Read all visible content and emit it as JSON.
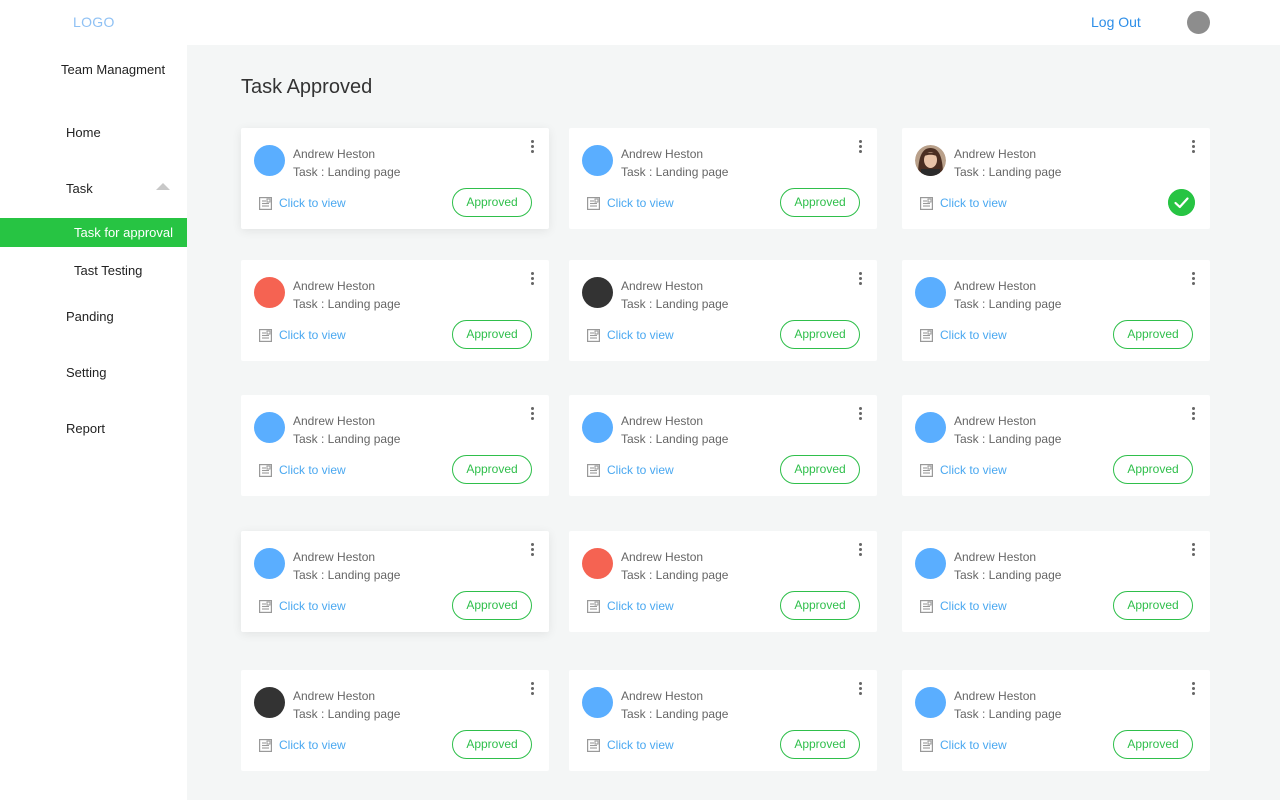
{
  "header": {
    "logo": "LOGO",
    "logout_label": "Log Out"
  },
  "sidebar": {
    "brand": "Team Managment",
    "items": [
      {
        "label": "Home"
      },
      {
        "label": "Task"
      },
      {
        "label": "Task for approval"
      },
      {
        "label": "Tast Testing"
      },
      {
        "label": "Panding"
      },
      {
        "label": "Setting"
      },
      {
        "label": "Report"
      }
    ]
  },
  "main": {
    "title": "Task Approved"
  },
  "colors": {
    "accent_green": "#27c443",
    "link_blue": "#4aa8f0",
    "avatar_blue": "#5aaeff",
    "avatar_red": "#f56352",
    "avatar_dark": "#333333"
  },
  "cards": [
    {
      "name": "Andrew Heston",
      "task": "Task : Landing page",
      "link": "Click to view",
      "status": "Approved",
      "avatar": "blue",
      "shadow": true
    },
    {
      "name": "Andrew Heston",
      "task": "Task : Landing page",
      "link": "Click to view",
      "status": "Approved",
      "avatar": "blue",
      "shadow": false
    },
    {
      "name": "Andrew Heston",
      "task": "Task : Landing page",
      "link": "Click to view",
      "status": "check-icon",
      "avatar": "photo",
      "shadow": false
    },
    {
      "name": "Andrew Heston",
      "task": "Task : Landing page",
      "link": "Click to view",
      "status": "Approved",
      "avatar": "red",
      "shadow": false
    },
    {
      "name": "Andrew Heston",
      "task": "Task : Landing page",
      "link": "Click to view",
      "status": "Approved",
      "avatar": "dark",
      "shadow": false
    },
    {
      "name": "Andrew Heston",
      "task": "Task : Landing page",
      "link": "Click to view",
      "status": "Approved",
      "avatar": "blue",
      "shadow": false
    },
    {
      "name": "Andrew Heston",
      "task": "Task : Landing page",
      "link": "Click to view",
      "status": "Approved",
      "avatar": "blue",
      "shadow": false
    },
    {
      "name": "Andrew Heston",
      "task": "Task : Landing page",
      "link": "Click to view",
      "status": "Approved",
      "avatar": "blue",
      "shadow": false
    },
    {
      "name": "Andrew Heston",
      "task": "Task : Landing page",
      "link": "Click to view",
      "status": "Approved",
      "avatar": "blue",
      "shadow": false
    },
    {
      "name": "Andrew Heston",
      "task": "Task : Landing page",
      "link": "Click to view",
      "status": "Approved",
      "avatar": "blue",
      "shadow": true
    },
    {
      "name": "Andrew Heston",
      "task": "Task : Landing page",
      "link": "Click to view",
      "status": "Approved",
      "avatar": "red",
      "shadow": false
    },
    {
      "name": "Andrew Heston",
      "task": "Task : Landing page",
      "link": "Click to view",
      "status": "Approved",
      "avatar": "blue",
      "shadow": false
    },
    {
      "name": "Andrew Heston",
      "task": "Task : Landing page",
      "link": "Click to view",
      "status": "Approved",
      "avatar": "dark",
      "shadow": false
    },
    {
      "name": "Andrew Heston",
      "task": "Task : Landing page",
      "link": "Click to view",
      "status": "Approved",
      "avatar": "blue",
      "shadow": false
    },
    {
      "name": "Andrew Heston",
      "task": "Task : Landing page",
      "link": "Click to view",
      "status": "Approved",
      "avatar": "blue",
      "shadow": false
    }
  ]
}
